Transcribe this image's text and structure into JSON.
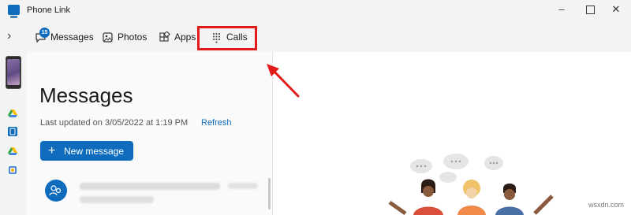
{
  "window": {
    "title": "Phone Link"
  },
  "nav": {
    "messages_label": "Messages",
    "messages_badge": "15",
    "photos_label": "Photos",
    "apps_label": "Apps",
    "calls_label": "Calls"
  },
  "messages": {
    "title": "Messages",
    "last_updated": "Last updated on 3/05/2022 at 1:19 PM",
    "refresh_label": "Refresh",
    "new_message_label": "New message"
  },
  "watermark": "wsxdn.com",
  "colors": {
    "accent": "#0f6cbd",
    "highlight": "#e21a1a"
  }
}
